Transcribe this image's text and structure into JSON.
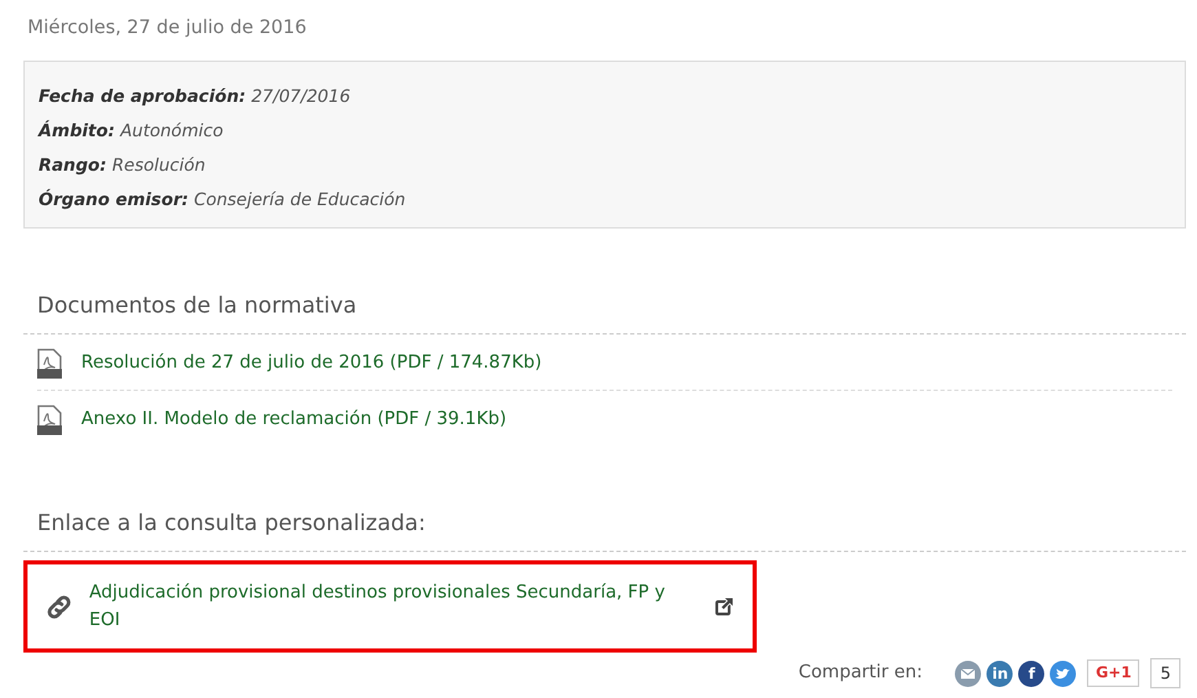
{
  "date": "Miércoles, 27 de julio de 2016",
  "info": [
    {
      "label": "Fecha de aprobación:",
      "value": "27/07/2016"
    },
    {
      "label": "Ámbito:",
      "value": "Autonómico"
    },
    {
      "label": "Rango:",
      "value": "Resolución"
    },
    {
      "label": "Órgano emisor:",
      "value": "Consejería de Educación"
    }
  ],
  "documents": {
    "heading": "Documentos de la normativa",
    "items": [
      {
        "text": "Resolución de 27 de julio de 2016 (PDF / 174.87Kb)"
      },
      {
        "text": "Anexo II. Modelo de reclamación (PDF / 39.1Kb)"
      }
    ]
  },
  "custom_link": {
    "heading": "Enlace a la consulta personalizada:",
    "text": "Adjudicación provisional destinos provisionales Secundaría, FP y EOI",
    "highlighted": true
  },
  "share": {
    "label": "Compartir en:",
    "services": [
      {
        "kind": "mail",
        "color": "#8a9cad"
      },
      {
        "kind": "glyph",
        "glyph": "in",
        "color": "#3a7bb0"
      },
      {
        "kind": "glyph",
        "glyph": "f",
        "color": "#274a8a"
      },
      {
        "kind": "bird",
        "color": "#3b8fe0"
      }
    ],
    "plus_button": "G+1",
    "count": "5"
  }
}
